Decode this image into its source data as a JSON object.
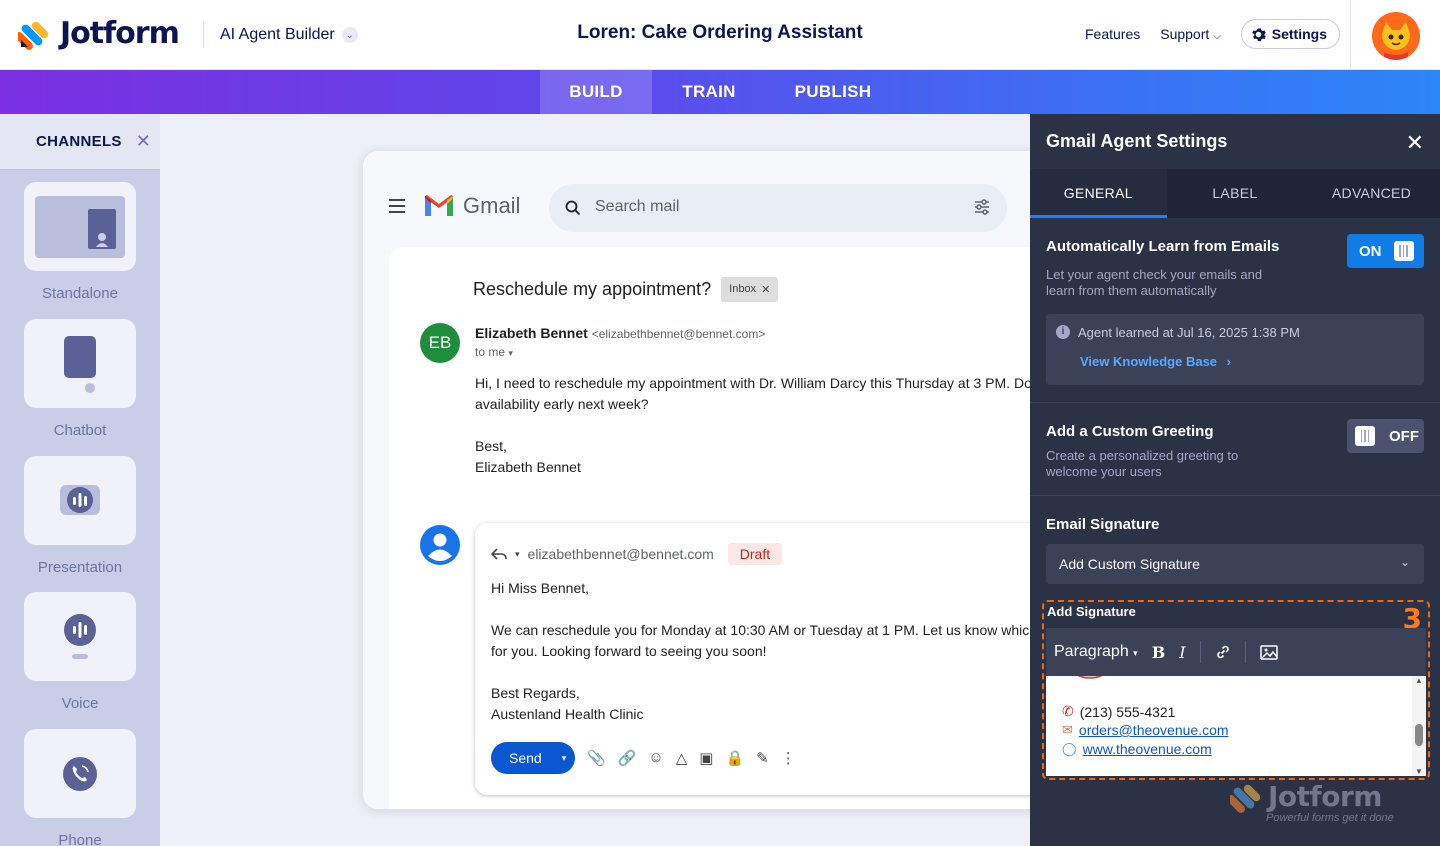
{
  "header": {
    "brand": "Jotform",
    "product": "AI Agent Builder",
    "title": "Loren: Cake Ordering Assistant",
    "links": {
      "features": "Features",
      "support": "Support",
      "settings": "Settings"
    }
  },
  "tabs": {
    "build": "BUILD",
    "train": "TRAIN",
    "publish": "PUBLISH"
  },
  "channels": {
    "heading": "CHANNELS",
    "items": [
      {
        "label": "Standalone",
        "icon": "standalone-icon"
      },
      {
        "label": "Chatbot",
        "icon": "chatbot-icon"
      },
      {
        "label": "Presentation",
        "icon": "presentation-icon"
      },
      {
        "label": "Voice",
        "icon": "voice-icon"
      },
      {
        "label": "Phone",
        "icon": "phone-icon"
      }
    ]
  },
  "gmail": {
    "brand": "Gmail",
    "search_placeholder": "Search mail",
    "subject": "Reschedule my appointment?",
    "inbox_chip": "Inbox",
    "sender_initials": "EB",
    "sender_name": "Elizabeth Bennet",
    "sender_email": "<elizabethbennet@bennet.com>",
    "to_me": "to me",
    "message": {
      "line1": "Hi, I need to reschedule my appointment with Dr. William Darcy this Thursday at 3 PM. Do",
      "line2": "availability early next week?",
      "line3": "Best,",
      "line4": "Elizabeth Bennet"
    },
    "reply": {
      "to": "elizabethbennet@bennet.com",
      "draft": "Draft",
      "line1": "Hi Miss Bennet,",
      "line2": "We can reschedule you for Monday at 10:30 AM or Tuesday at 1 PM. Let us know whic",
      "line3": "for you. Looking forward to seeing you soon!",
      "line4": "Best Regards,",
      "line5": "Austenland Health Clinic",
      "send": "Send"
    }
  },
  "panel": {
    "title": "Gmail Agent Settings",
    "tabs": {
      "general": "GENERAL",
      "label": "LABEL",
      "advanced": "ADVANCED"
    },
    "auto_learn": {
      "title": "Automatically Learn from Emails",
      "desc1": "Let your agent check your emails and",
      "desc2": "learn from them automatically",
      "toggle": "ON",
      "learned": "Agent learned at Jul 16, 2025 1:38 PM",
      "kb_link": "View Knowledge Base"
    },
    "greeting": {
      "title": "Add a Custom Greeting",
      "desc1": "Create a personalized greeting to",
      "desc2": "welcome your users",
      "toggle": "OFF"
    },
    "signature": {
      "title": "Email Signature",
      "dropdown": "Add Custom Signature",
      "add_title": "Add Signature",
      "step": "3",
      "paragraph": "Paragraph",
      "bold": "B",
      "italic": "I",
      "phone": "(213) 555-4321",
      "email": "orders@theovenue.com",
      "website": "www.theovenue.com"
    }
  },
  "watermark": {
    "brand": "Jotform",
    "tagline": "Powerful forms get it done"
  },
  "colors": {
    "accent": "#0f7ce8",
    "panel_bg": "#2b3245",
    "step_highlight": "#e66b19"
  }
}
